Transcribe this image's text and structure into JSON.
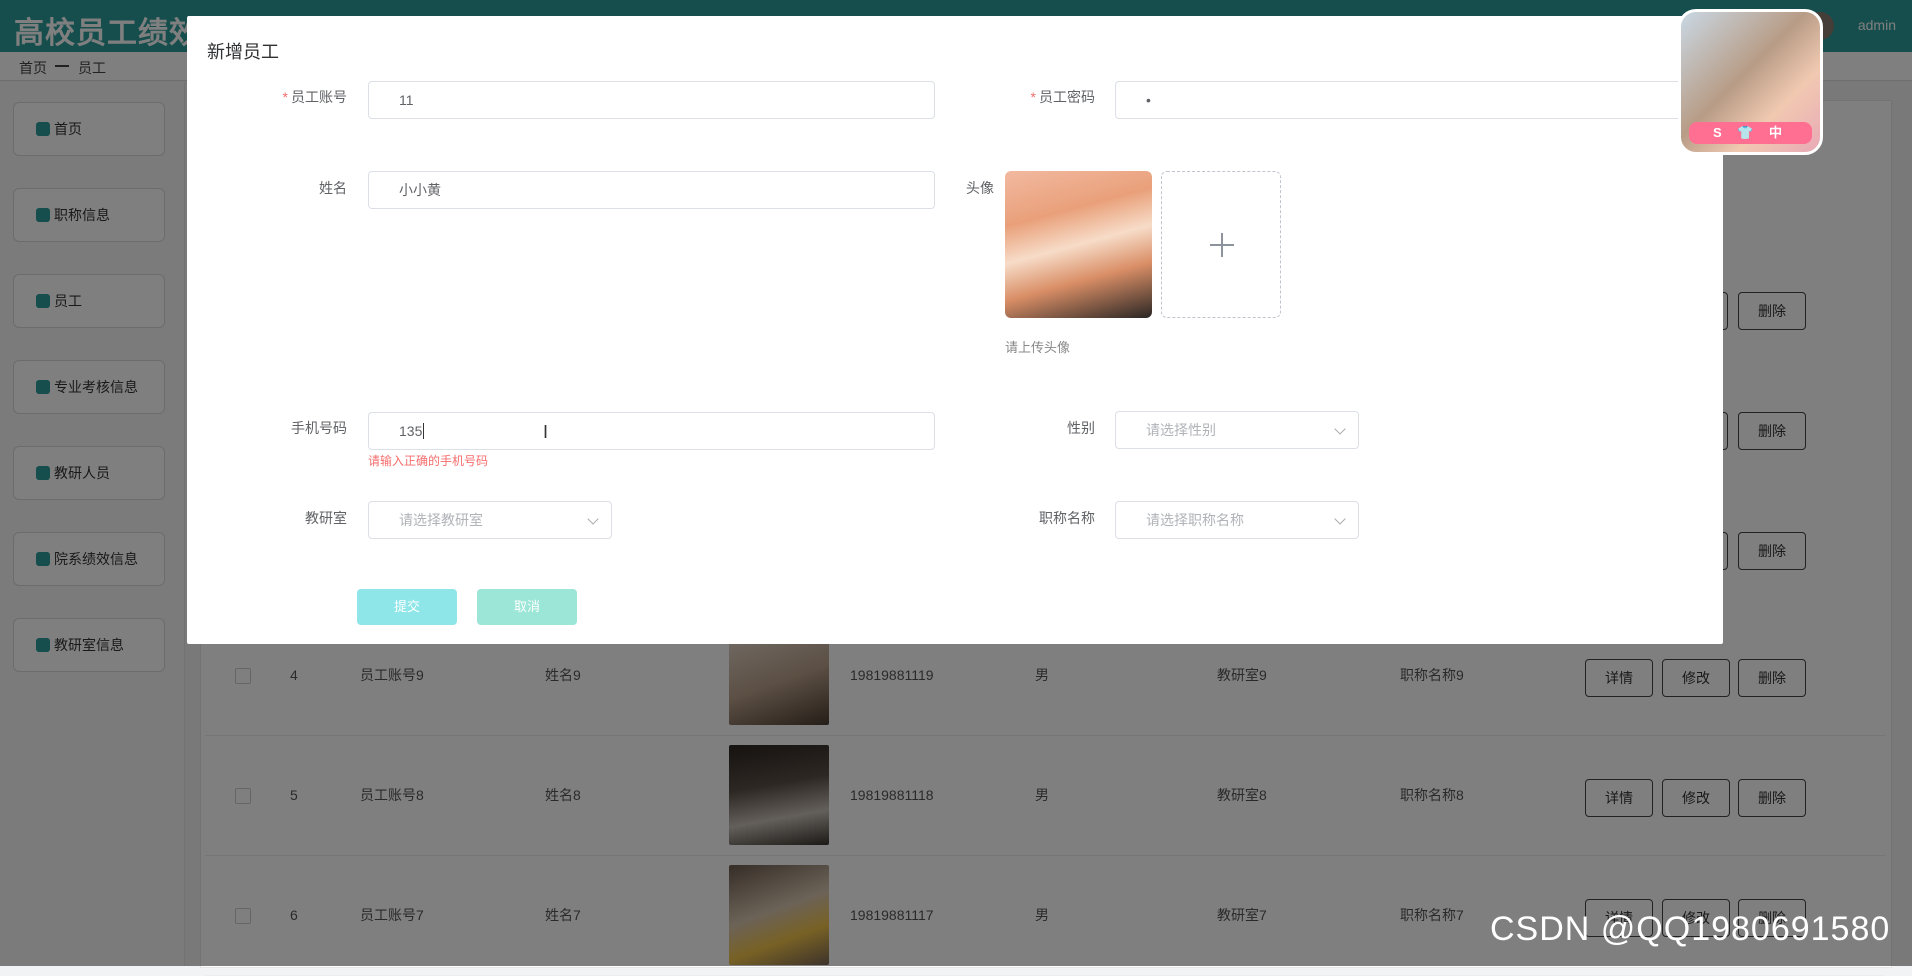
{
  "app": {
    "title": "高校员工绩效管理系统",
    "user": "admin"
  },
  "breadcrumb": {
    "home": "首页",
    "current": "员工"
  },
  "sidebar": {
    "items": [
      "首页",
      "职称信息",
      "员工",
      "专业考核信息",
      "教研人员",
      "院系绩效信息",
      "教研室信息"
    ]
  },
  "table": {
    "rows": [
      {
        "index": "4",
        "account": "员工账号9",
        "name": "姓名9",
        "phone": "19819881119",
        "gender": "男",
        "room": "教研室9",
        "title": "职称名称9"
      },
      {
        "index": "5",
        "account": "员工账号8",
        "name": "姓名8",
        "phone": "19819881118",
        "gender": "男",
        "room": "教研室8",
        "title": "职称名称8"
      },
      {
        "index": "6",
        "account": "员工账号7",
        "name": "姓名7",
        "phone": "19819881117",
        "gender": "男",
        "room": "教研室7",
        "title": "职称名称7"
      }
    ],
    "ops": {
      "detail": "详情",
      "edit": "修改",
      "delete": "删除"
    }
  },
  "dialog": {
    "title": "新增员工",
    "required_mark": "*",
    "fields": {
      "account": {
        "label": "员工账号",
        "value": "11"
      },
      "password": {
        "label": "员工密码",
        "value": "•"
      },
      "name": {
        "label": "姓名",
        "value": "小小黄"
      },
      "avatar": {
        "label": "头像",
        "tip": "请上传头像"
      },
      "phone": {
        "label": "手机号码",
        "value": "135",
        "error": "请输入正确的手机号码"
      },
      "gender": {
        "label": "性别",
        "placeholder": "请选择性别"
      },
      "room": {
        "label": "教研室",
        "placeholder": "请选择教研室"
      },
      "title": {
        "label": "职称名称",
        "placeholder": "请选择职称名称"
      }
    },
    "buttons": {
      "submit": "提交",
      "cancel": "取消"
    }
  },
  "float_card": {
    "badge": "S 👕 中"
  },
  "watermark": "CSDN @QQ1980691580"
}
